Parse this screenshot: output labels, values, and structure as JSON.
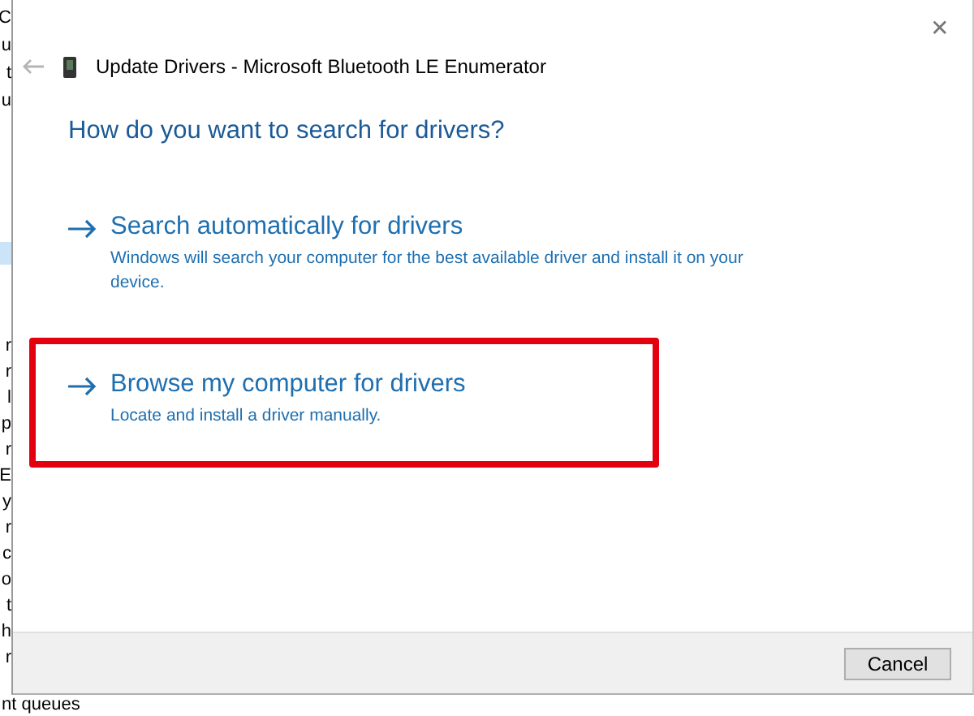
{
  "background_window": {
    "fragments_top": [
      "C",
      "u",
      "t",
      "u"
    ],
    "fragments_bottom": [
      "r",
      "r",
      "l",
      "p",
      "r",
      "E",
      "y",
      "r",
      "c",
      "o",
      "t",
      "h",
      "r"
    ],
    "bottom_text": "nt queues"
  },
  "dialog": {
    "title": "Update Drivers - Microsoft Bluetooth LE Enumerator",
    "close": "✕",
    "heading": "How do you want to search for drivers?",
    "options": [
      {
        "title": "Search automatically for drivers",
        "description": "Windows will search your computer for the best available driver and install it on your device.",
        "highlighted": false
      },
      {
        "title": "Browse my computer for drivers",
        "description": "Locate and install a driver manually.",
        "highlighted": true
      }
    ],
    "buttons": [
      "Cancel"
    ]
  }
}
